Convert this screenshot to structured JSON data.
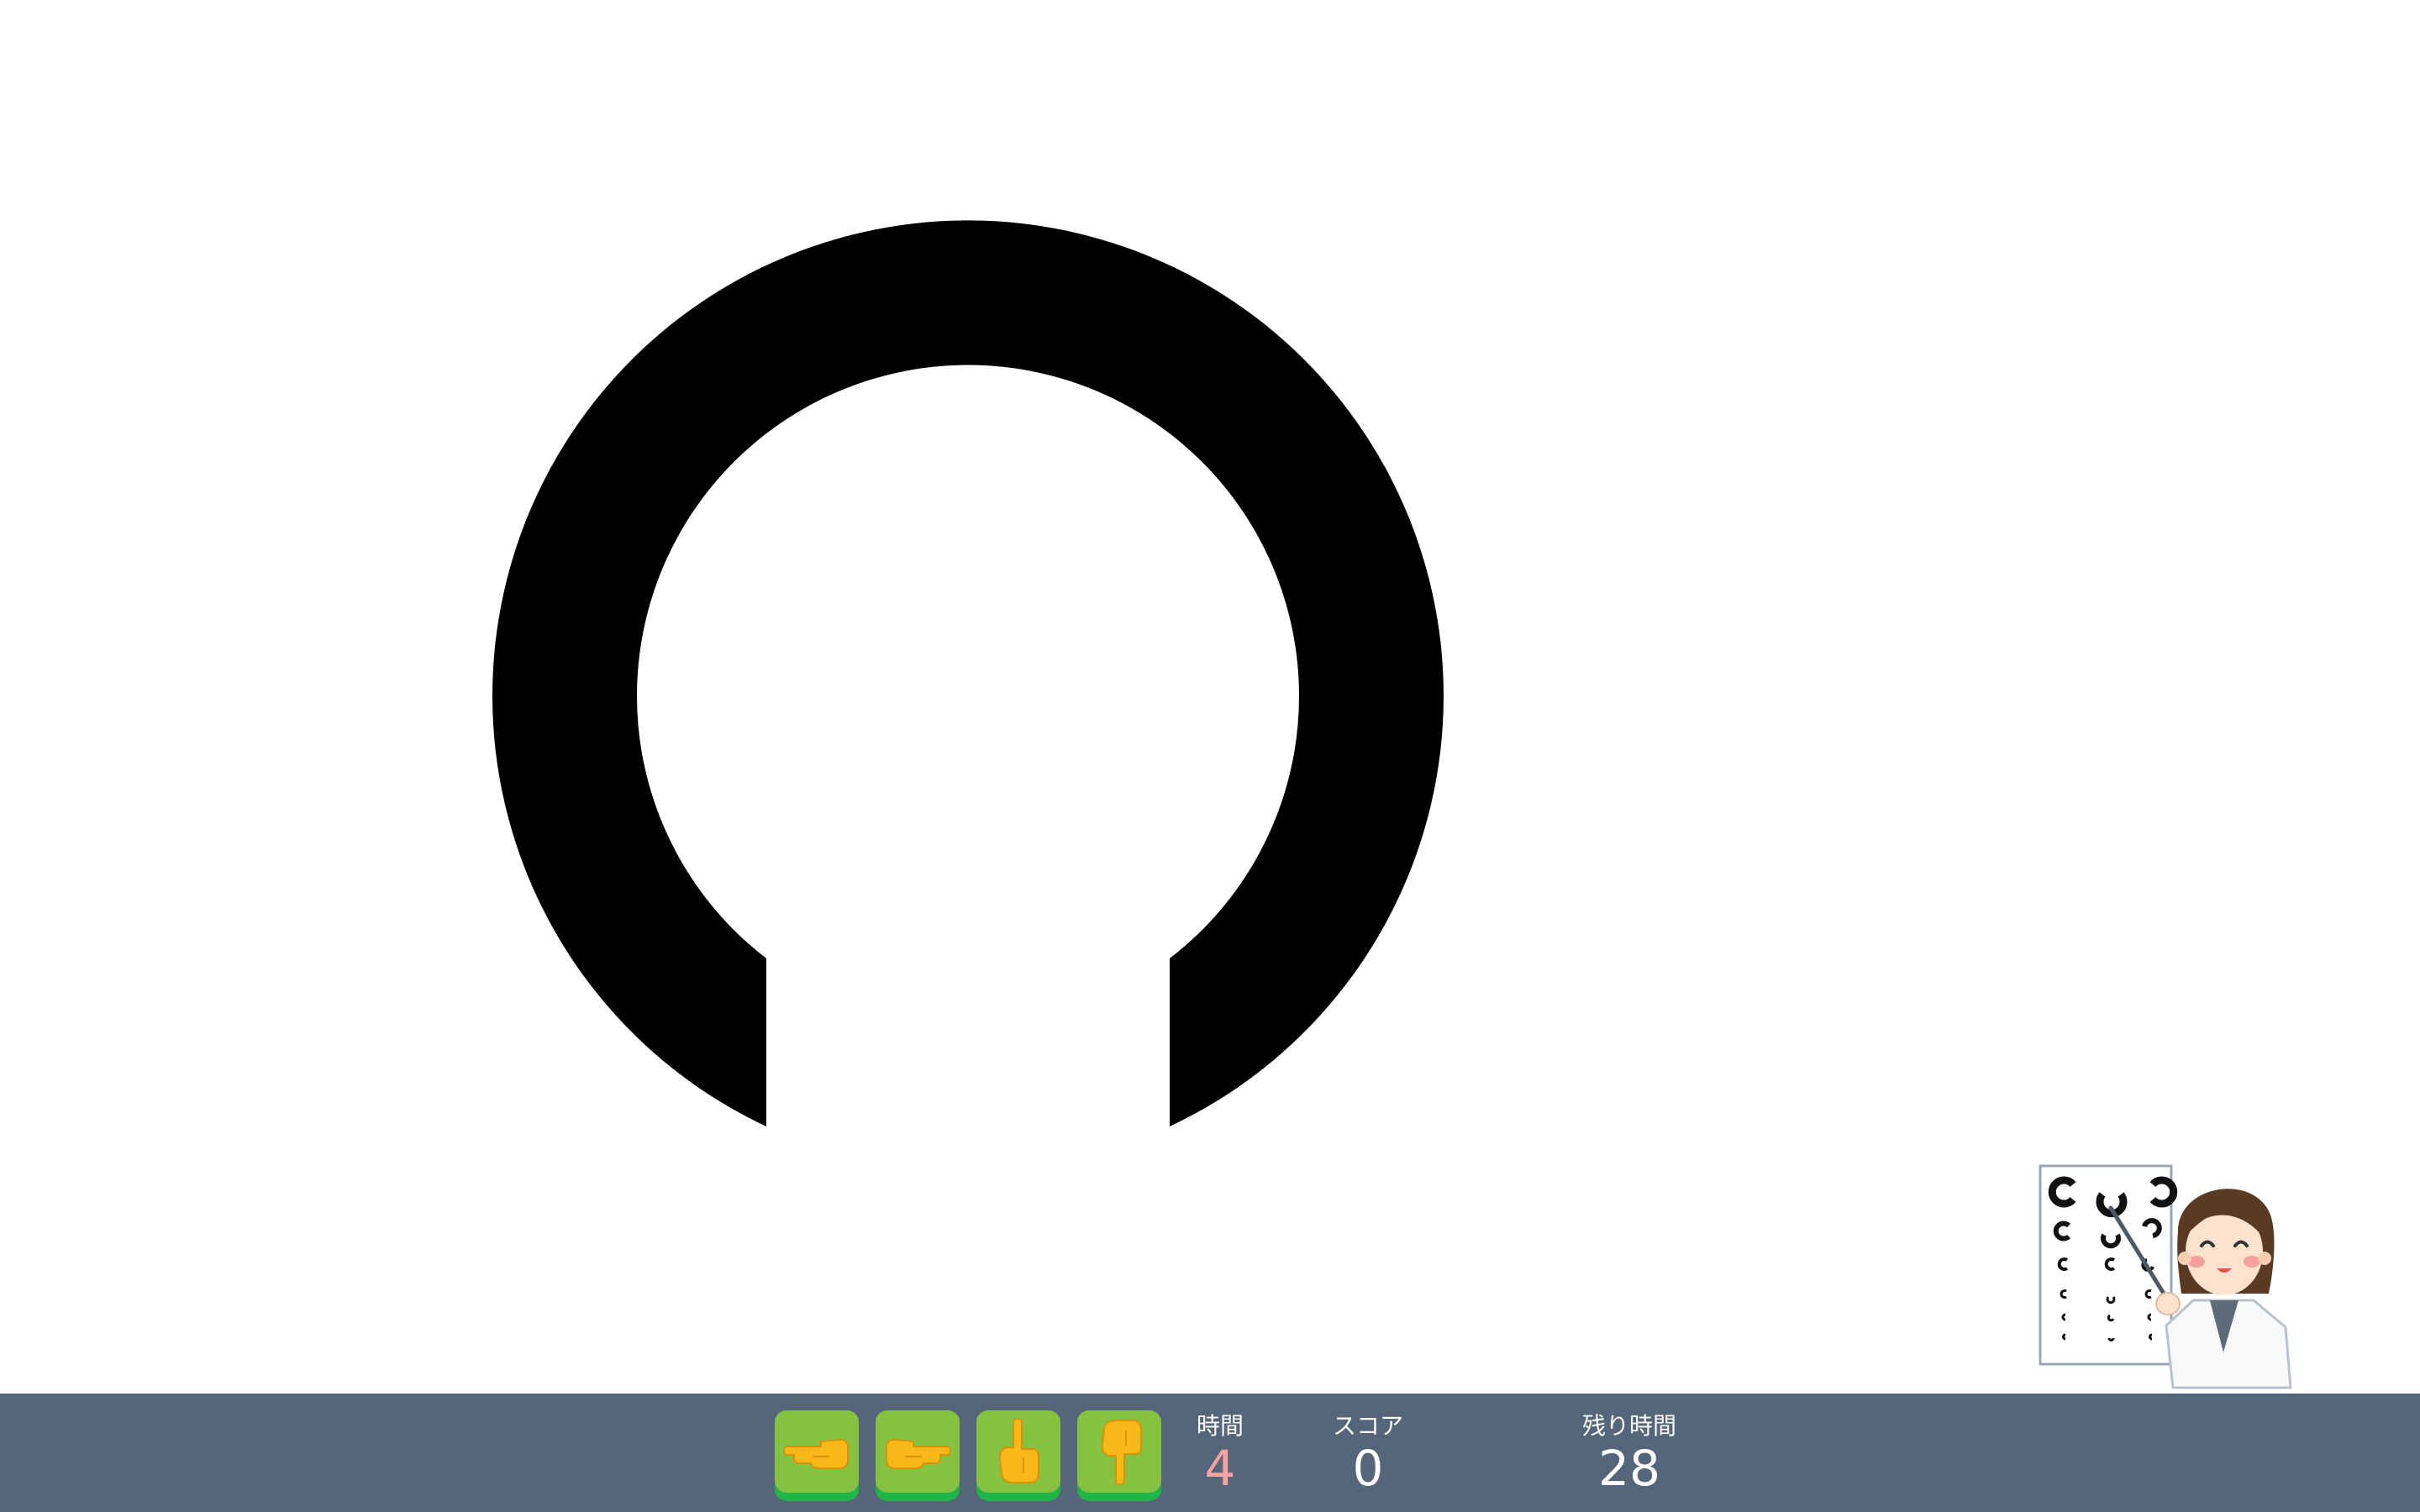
{
  "game": {
    "target": {
      "gap_direction": "down"
    },
    "controls": {
      "buttons": [
        {
          "icon": "point-left-hand-icon",
          "direction": "left"
        },
        {
          "icon": "point-right-hand-icon",
          "direction": "right"
        },
        {
          "icon": "point-up-hand-icon",
          "direction": "up"
        },
        {
          "icon": "point-down-hand-icon",
          "direction": "down"
        }
      ]
    },
    "stats": {
      "time_label": "時間",
      "time_value": "4",
      "score_label": "スコア",
      "score_value": "0",
      "remaining_label": "残り時間",
      "remaining_value": "28"
    },
    "colors": {
      "ring": "#000000",
      "bar": "#55667a",
      "button_face": "#86c141",
      "button_edge": "#1fb34a",
      "time_value": "#f4a3a3",
      "text": "#ffffff"
    },
    "illustration": {
      "icon": "doctor-with-eye-chart-icon"
    }
  }
}
